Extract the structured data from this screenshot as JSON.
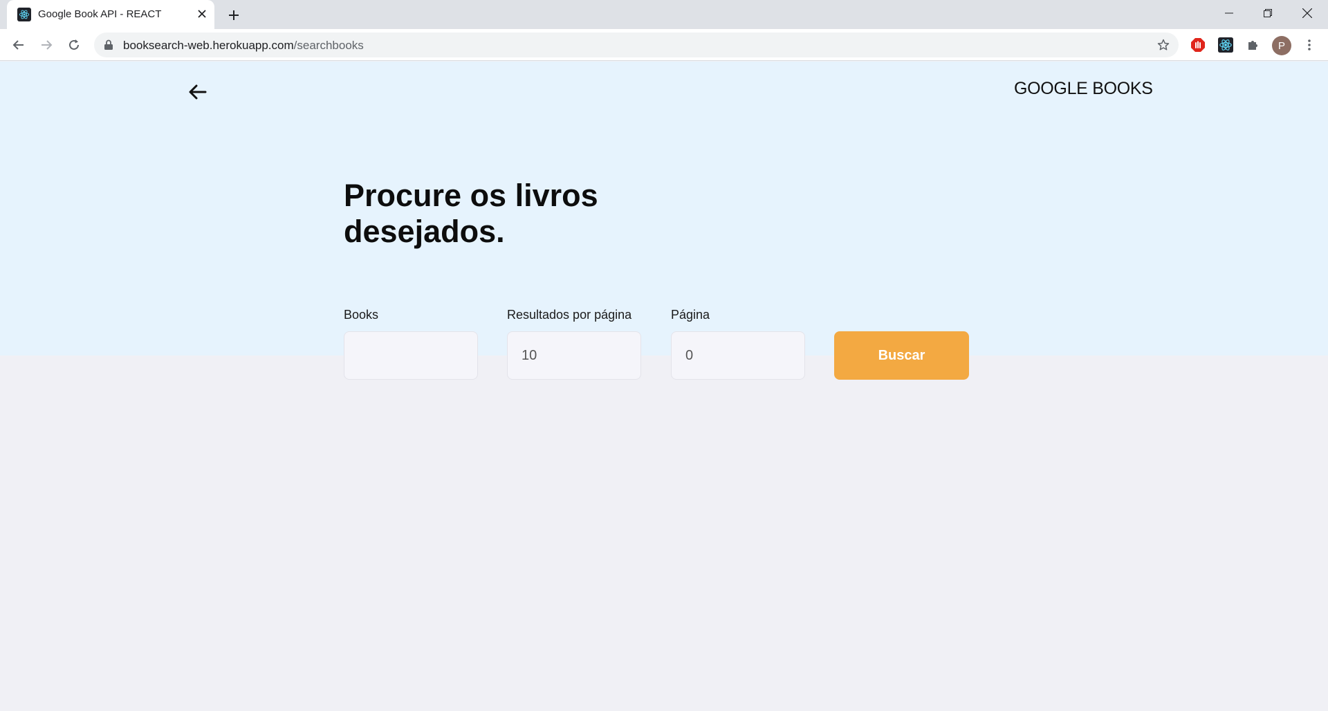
{
  "browser": {
    "tab": {
      "title": "Google Book API - REACT",
      "favicon": "react-icon"
    },
    "address": {
      "domain": "booksearch-web.herokuapp.com",
      "path": "/searchbooks"
    },
    "avatar_initial": "P",
    "extensions": [
      "adblock-icon",
      "react-devtools-icon",
      "puzzle-icon"
    ]
  },
  "header": {
    "brand": "GOOGLE BOOKS"
  },
  "hero": {
    "headline_line1": "Procure os livros",
    "headline_line2": "desejados."
  },
  "form": {
    "books": {
      "label": "Books",
      "value": ""
    },
    "per_page": {
      "label": "Resultados por página",
      "value": "10"
    },
    "page": {
      "label": "Página",
      "value": "0"
    },
    "submit_label": "Buscar"
  },
  "colors": {
    "hero_bg": "#e6f3fd",
    "page_bg": "#f0f0f5",
    "accent": "#f3a942"
  }
}
